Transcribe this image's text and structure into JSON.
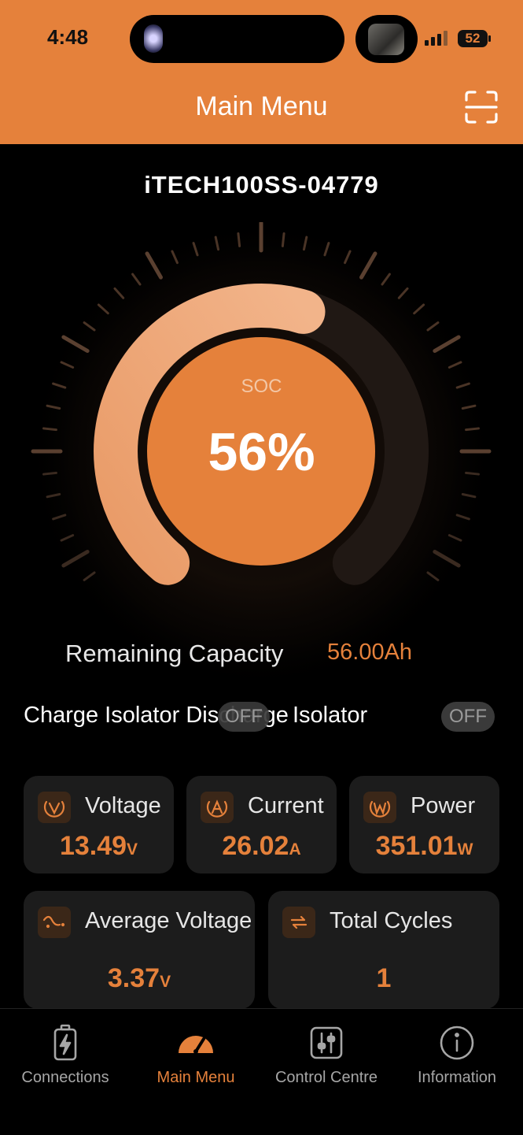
{
  "status_bar": {
    "time": "4:48",
    "battery": "52"
  },
  "header": {
    "title": "Main Menu"
  },
  "device": {
    "name": "iTECH100SS-04779"
  },
  "soc": {
    "label": "SOC",
    "value": "56%",
    "fraction": 0.56
  },
  "capacity": {
    "label": "Remaining Capacity",
    "value": "56.00Ah"
  },
  "isolators": {
    "charge_label": "Charge Isolator Discharge",
    "charge_state": "OFF",
    "discharge_label": "Isolator",
    "discharge_state": "OFF"
  },
  "metrics": {
    "voltage": {
      "label": "Voltage",
      "value": "13.49",
      "unit": "V",
      "icon": "voltage-icon"
    },
    "current": {
      "label": "Current",
      "value": "26.02",
      "unit": "A",
      "icon": "current-icon"
    },
    "power": {
      "label": "Power",
      "value": "351.01",
      "unit": "W",
      "icon": "power-icon"
    },
    "avg_voltage": {
      "label": "Average Voltage",
      "value": "3.37",
      "unit": "V",
      "icon": "wave-icon"
    },
    "cycles": {
      "label": "Total Cycles",
      "value": "1",
      "icon": "cycle-icon"
    }
  },
  "tabs": [
    {
      "label": "Connections",
      "icon": "battery-charge-icon",
      "active": false
    },
    {
      "label": "Main Menu",
      "icon": "gauge-icon",
      "active": true
    },
    {
      "label": "Control Centre",
      "icon": "sliders-icon",
      "active": false
    },
    {
      "label": "Information",
      "icon": "info-icon",
      "active": false
    }
  ],
  "colors": {
    "accent": "#e5813b",
    "arc_light": "#f0a97a",
    "card": "#1c1c1c",
    "background": "#000000"
  }
}
